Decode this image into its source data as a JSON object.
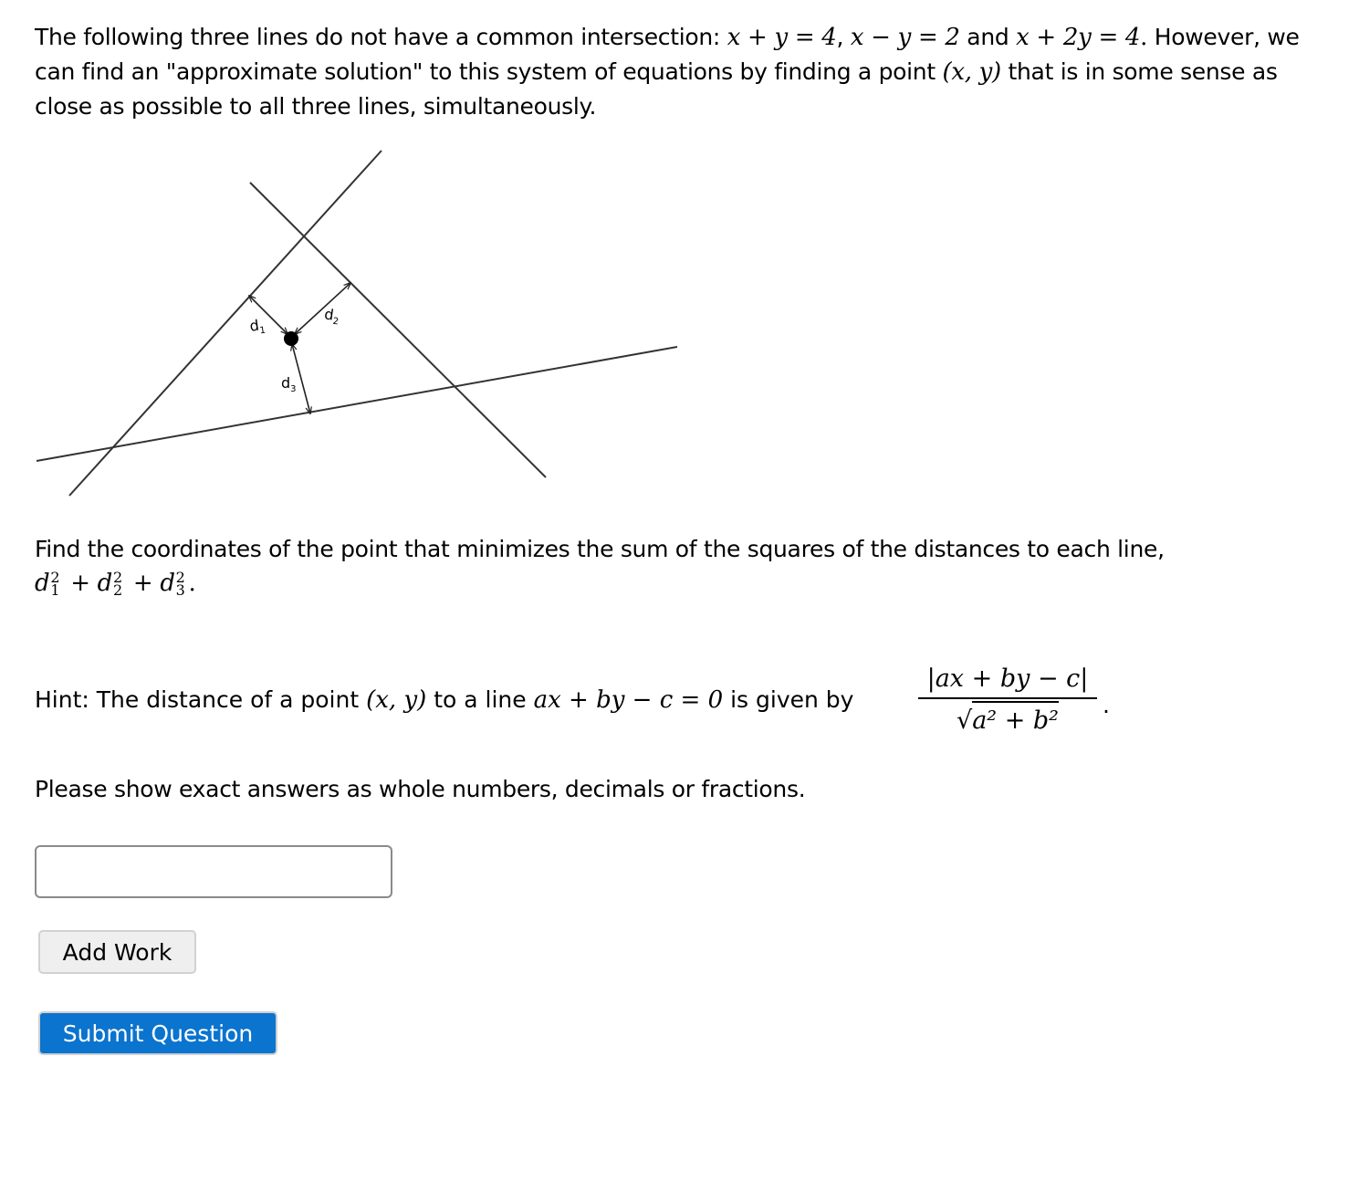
{
  "intro": {
    "text_a": "The following three lines do not have a common intersection: ",
    "eq1": "x + y = 4",
    "sep1": ", ",
    "eq2": "x − y = 2",
    "and": " and ",
    "eq3": "x + 2y = 4",
    "period": ".",
    "text_b": " However, we can find an \"approximate solution\" to this system of equations by finding a point ",
    "point": "(x, y)",
    "text_c": " that is in some sense as close as possible to all three lines, simultaneously."
  },
  "figure": {
    "labels": {
      "d1": "d",
      "d1_sub": "1",
      "d2": "d",
      "d2_sub": "2",
      "d3": "d",
      "d3_sub": "3"
    }
  },
  "question": {
    "text": "Find the coordinates of the point that minimizes the sum of the squares of the distances to each line,",
    "d": "d",
    "plus": " + ",
    "sup": "2",
    "sub1": "1",
    "sub2": "2",
    "sub3": "3",
    "period": "."
  },
  "hint": {
    "text_a": "Hint: The distance of a point ",
    "point": "(x, y)",
    "text_b": " to a line ",
    "line_eq": "ax + by − c = 0",
    "text_c": " is given by",
    "numerator": "|ax + by − c|",
    "sqrt_symbol": "√",
    "denominator": "a² + b²",
    "period": "."
  },
  "instructions": "Please show exact answers as whole numbers, decimals or fractions.",
  "answer_input": {
    "value": "",
    "placeholder": ""
  },
  "buttons": {
    "add_work": "Add Work",
    "submit": "Submit Question"
  }
}
